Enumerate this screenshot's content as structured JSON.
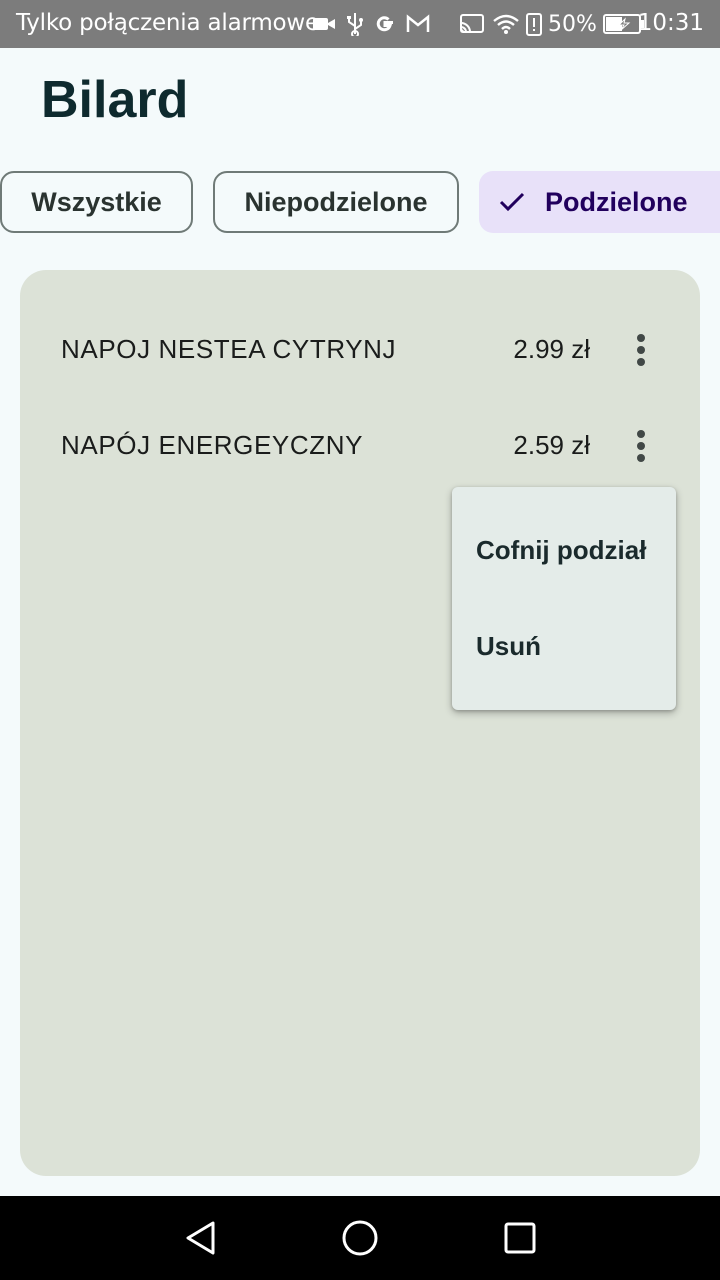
{
  "status_bar": {
    "carrier_text": "Tylko połączenia alarmowe",
    "battery": "50%",
    "time": "10:31",
    "icons_left": [
      "video-icon",
      "usb-icon",
      "google-icon",
      "gmail-icon"
    ],
    "icons_right": [
      "cast-icon",
      "wifi-icon",
      "battery-alert-icon",
      "battery-charging-icon"
    ]
  },
  "header": {
    "title": "Bilard"
  },
  "filters": {
    "all": "Wszystkie",
    "undivided": "Niepodzielone",
    "divided": "Podzielone",
    "selected": "divided"
  },
  "items": [
    {
      "name": "NAPOJ NESTEA CYTRYNJ",
      "price": "2.99 zł"
    },
    {
      "name": "NAPÓJ ENERGEYCZNY",
      "price": "2.59 zł"
    }
  ],
  "context_menu": {
    "undo_split": "Cofnij podział",
    "delete": "Usuń"
  },
  "nav_bar": {
    "buttons": [
      "back-icon",
      "home-icon",
      "recents-icon"
    ]
  },
  "colors": {
    "background": "#F4FAFB",
    "card": "#DCE2D7",
    "chip_selected": "#E8E1F9",
    "chip_selected_text": "#21005D",
    "title": "#0E2A2E"
  }
}
